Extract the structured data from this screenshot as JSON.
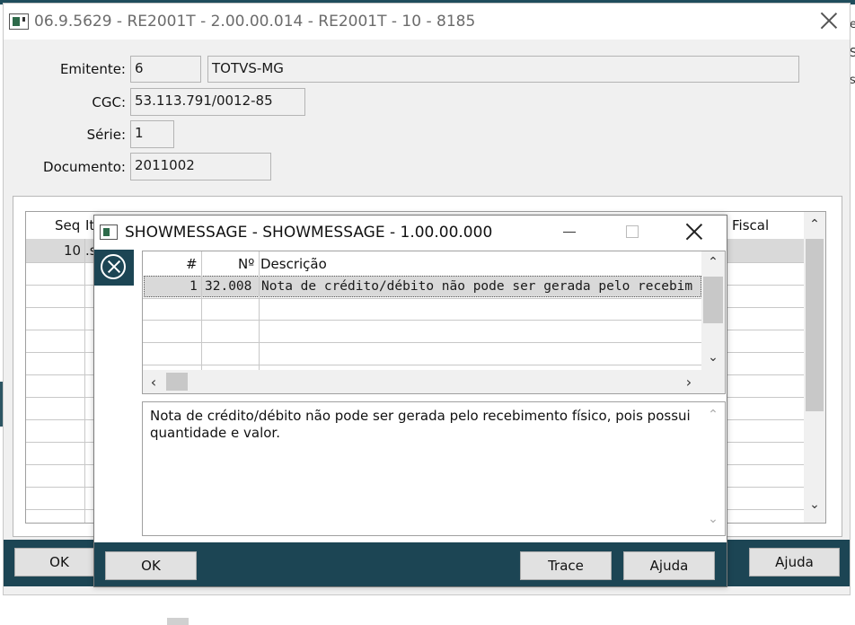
{
  "background": {
    "right_glyphs": [
      "e",
      "S",
      "s"
    ]
  },
  "main_window": {
    "title": "06.9.5629 - RE2001T - 2.00.00.014 - RE2001T - 10 - 8185",
    "fields": {
      "emitente_label": "Emitente:",
      "emitente_code": "6",
      "emitente_name": "TOTVS-MG",
      "cgc_label": "CGC:",
      "cgc_value": "53.113.791/0012-85",
      "serie_label": "Série:",
      "serie_value": "1",
      "documento_label": "Documento:",
      "documento_value": "2011002"
    },
    "grid": {
      "col_seq": "Seq",
      "col_item_partial": "It",
      "col_fiscal": "Fiscal",
      "row1_seq": "10",
      "row1_item_partial": ".s"
    },
    "buttons": {
      "ok": "OK",
      "ajuda": "Ajuda"
    }
  },
  "dialog": {
    "title": "SHOWMESSAGE - SHOWMESSAGE - 1.00.00.000",
    "grid": {
      "col_hash": "#",
      "col_num": "Nº",
      "col_desc": "Descrição",
      "rows": [
        {
          "hash": "1",
          "num": "32.008",
          "desc": "Nota de crédito/débito não pode ser gerada pelo recebim"
        }
      ]
    },
    "message_line1": "Nota de crédito/débito não pode ser gerada pelo recebimento físico, pois possui",
    "message_line2": "quantidade e valor.",
    "buttons": {
      "ok": "OK",
      "trace": "Trace",
      "ajuda": "Ajuda"
    }
  },
  "colors": {
    "accent_dark": "#1c4554",
    "window_bg": "#f0f0f0",
    "selected_row": "#d9d9d9"
  }
}
